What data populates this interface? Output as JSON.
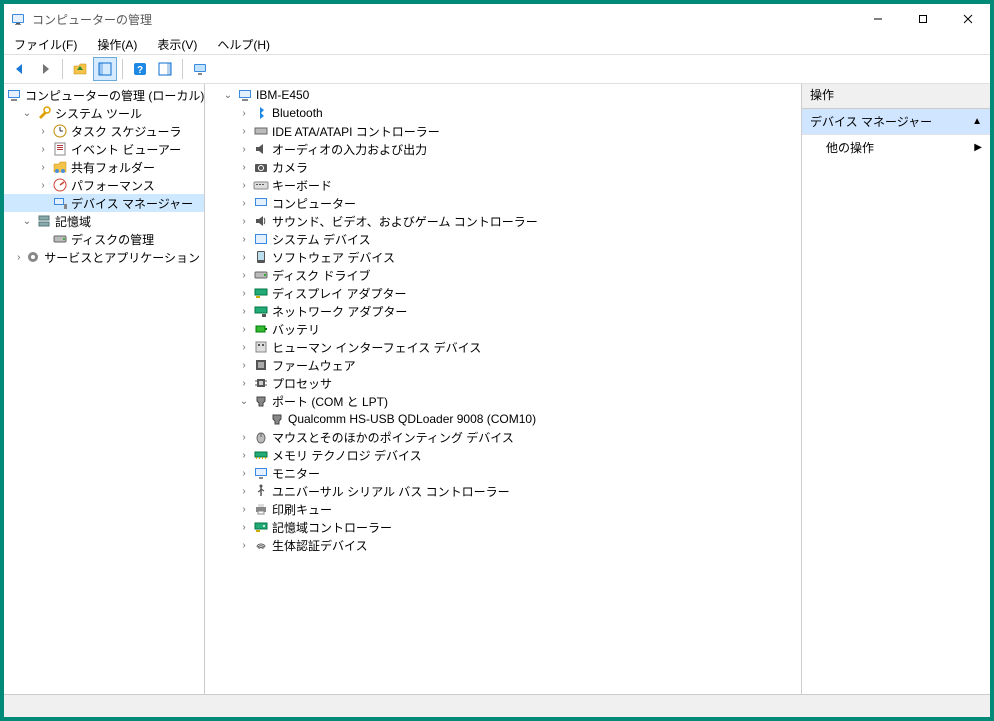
{
  "title": "コンピューターの管理",
  "menubar": {
    "file": "ファイル(F)",
    "action": "操作(A)",
    "view": "表示(V)",
    "help": "ヘルプ(H)"
  },
  "left_tree": {
    "root": "コンピューターの管理 (ローカル)",
    "system_tools": "システム ツール",
    "task_scheduler": "タスク スケジューラ",
    "event_viewer": "イベント ビューアー",
    "shared_folders": "共有フォルダー",
    "performance": "パフォーマンス",
    "device_manager": "デバイス マネージャー",
    "storage": "記憶域",
    "disk_mgmt": "ディスクの管理",
    "services_apps": "サービスとアプリケーション"
  },
  "device_tree": {
    "root": "IBM-E450",
    "bluetooth": "Bluetooth",
    "ide": "IDE ATA/ATAPI コントローラー",
    "audio_io": "オーディオの入力および出力",
    "camera": "カメラ",
    "keyboard": "キーボード",
    "computer": "コンピューター",
    "sound_video_game": "サウンド、ビデオ、およびゲーム コントローラー",
    "system_devices": "システム デバイス",
    "software_devices": "ソフトウェア デバイス",
    "disk_drives": "ディスク ドライブ",
    "display_adapters": "ディスプレイ アダプター",
    "network_adapters": "ネットワーク アダプター",
    "battery": "バッテリ",
    "hid": "ヒューマン インターフェイス デバイス",
    "firmware": "ファームウェア",
    "processors": "プロセッサ",
    "ports": "ポート (COM と LPT)",
    "port_qualcomm": "Qualcomm HS-USB QDLoader 9008 (COM10)",
    "mice": "マウスとそのほかのポインティング デバイス",
    "memory_tech": "メモリ テクノロジ デバイス",
    "monitors": "モニター",
    "usb_controllers": "ユニバーサル シリアル バス コントローラー",
    "print_queues": "印刷キュー",
    "storage_controllers": "記憶域コントローラー",
    "biometric": "生体認証デバイス"
  },
  "right_pane": {
    "header": "操作",
    "section1": "デバイス マネージャー",
    "section2": "他の操作"
  }
}
